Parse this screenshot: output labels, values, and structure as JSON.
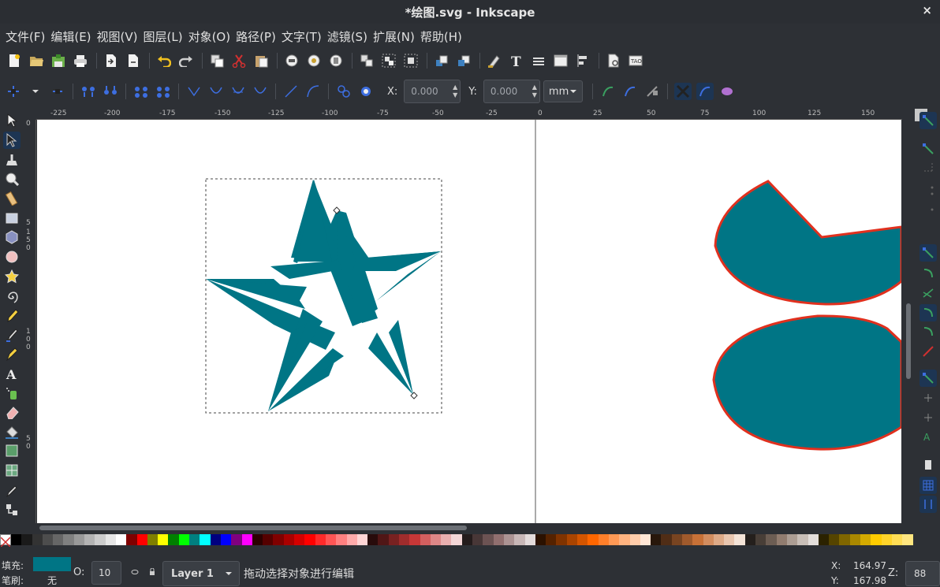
{
  "window": {
    "title": "*绘图.svg - Inkscape",
    "close_glyph": "×"
  },
  "menu": [
    "文件(F)",
    "编辑(E)",
    "视图(V)",
    "图层(L)",
    "对象(O)",
    "路径(P)",
    "文字(T)",
    "滤镜(S)",
    "扩展(N)",
    "帮助(H)"
  ],
  "tool_controls": {
    "x_label": "X:",
    "x_value": "0.000",
    "y_label": "Y:",
    "y_value": "0.000",
    "unit": "mm"
  },
  "rulers": {
    "h_labels": [
      "-225",
      "-200",
      "-175",
      "-150",
      "-125",
      "-100",
      "-75",
      "-50",
      "-25",
      "0",
      "25",
      "50",
      "75",
      "100",
      "125",
      "150"
    ],
    "v_labels": [
      "0",
      "5",
      "1",
      "5",
      "0",
      "1",
      "0",
      "0",
      "5",
      "0"
    ]
  },
  "colors": {
    "shape_fill": "#007585",
    "shape_stroke": "#e0301e",
    "canvas": "#ffffff",
    "accent": "#1d3553"
  },
  "status": {
    "fill_label": "填充:",
    "stroke_label": "笔刷:",
    "stroke_value": "无",
    "opacity_label": "O:",
    "opacity_value": "10",
    "layer": "Layer 1",
    "message": "拖动选择对象进行编辑",
    "x_label": "X:",
    "x_value": "164.97",
    "y_label": "Y:",
    "y_value": "167.98",
    "zoom_label": "Z:",
    "zoom_value": "88"
  },
  "icons": {
    "command_bar": [
      "new-document-icon",
      "open-icon",
      "save-icon",
      "print-icon",
      "import-icon",
      "export-icon",
      "undo-icon",
      "redo-icon",
      "duplicate-icon",
      "cut-icon",
      "paste-icon",
      "zoom-selection-icon",
      "zoom-drawing-icon",
      "zoom-page-icon",
      "group-icon",
      "ungroup-icon",
      "clone-icon",
      "raise-icon",
      "lower-icon",
      "fill-stroke-icon",
      "text-font-icon",
      "layers-icon",
      "xml-editor-icon",
      "align-icon",
      "document-properties-icon",
      "preferences-icon"
    ],
    "tools": [
      "selector-icon",
      "node-tool-icon",
      "tweak-tool-icon",
      "zoom-tool-icon",
      "measure-tool-icon",
      "rectangle-tool-icon",
      "box-3d-tool-icon",
      "ellipse-tool-icon",
      "star-tool-icon",
      "spiral-tool-icon",
      "pencil-tool-icon",
      "pen-tool-icon",
      "calligraphy-tool-icon",
      "text-tool-icon",
      "spray-tool-icon",
      "eraser-tool-icon",
      "bucket-fill-icon",
      "gradient-tool-icon",
      "mesh-tool-icon",
      "dropper-icon",
      "connector-tool-icon"
    ]
  }
}
